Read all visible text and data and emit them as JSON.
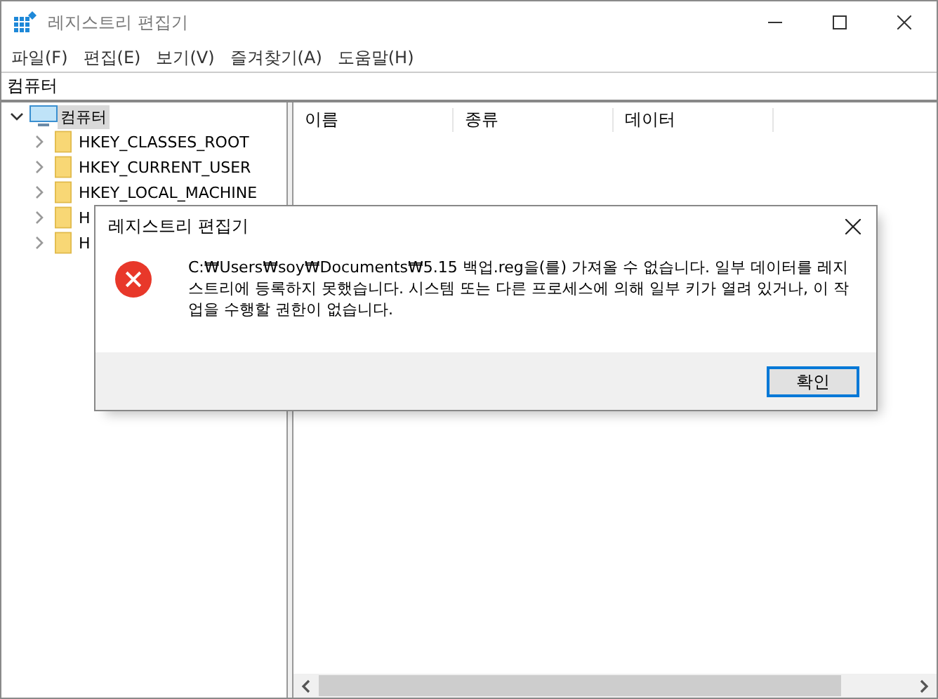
{
  "window": {
    "title": "레지스트리 편집기"
  },
  "menu": [
    "파일(F)",
    "편집(E)",
    "보기(V)",
    "즐겨찾기(A)",
    "도움말(H)"
  ],
  "address": "컴퓨터",
  "tree": {
    "label": "컴퓨터",
    "expanded": true,
    "selected": true,
    "children": [
      {
        "label": "HKEY_CLASSES_ROOT",
        "expanded": false
      },
      {
        "label": "HKEY_CURRENT_USER",
        "expanded": false
      },
      {
        "label": "HKEY_LOCAL_MACHINE",
        "expanded": false
      },
      {
        "label": "H",
        "expanded": false
      },
      {
        "label": "H",
        "expanded": false
      }
    ]
  },
  "table": {
    "columns": [
      "이름",
      "종류",
      "데이터"
    ]
  },
  "dialog": {
    "title": "레지스트리 편집기",
    "kind": "error",
    "message": "C:₩Users₩soy₩Documents₩5.15 백업.reg을(를) 가져올 수 없습니다. 일부 데이터를 레지스트리에 등록하지 못했습니다. 시스템 또는 다른 프로세스에 의해 일부 키가 열려 있거나, 이 작업을 수행할 권한이 없습니다.",
    "buttons": [
      "확인"
    ]
  }
}
